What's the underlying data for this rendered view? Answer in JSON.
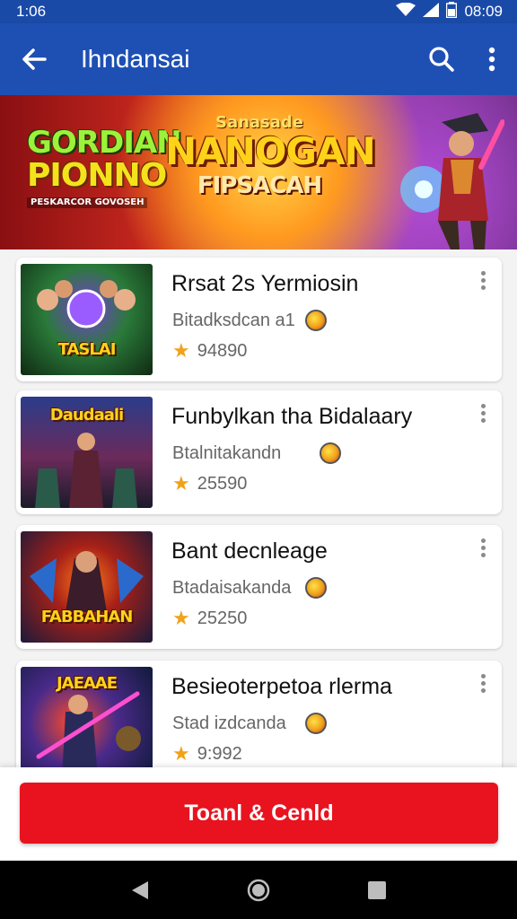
{
  "status_bar": {
    "left_time": "1:06",
    "right_time": "08:09"
  },
  "app_bar": {
    "title": "Ihndansai"
  },
  "banner": {
    "left_title_1": "GORDIAN",
    "left_title_2": "PIONNO",
    "left_subtitle": "PESKARCOR GOVOSEH",
    "center_small": "Sanasade",
    "center_title": "NANOGAN",
    "center_sub": "FIPSACAH"
  },
  "thumb_labels": [
    "TASLAI",
    "Daudaali",
    "FABBAHAN",
    "JAEAAE"
  ],
  "items": [
    {
      "name": "Rrsat 2s Yermiosin",
      "developer": "Bitadksdcan a1",
      "rating": "94890"
    },
    {
      "name": "Funbylkan tha Bidalaary",
      "developer": "Btalnitakandn",
      "rating": "25590"
    },
    {
      "name": "Bant decnleage",
      "developer": "Btadaisakanda",
      "rating": "25250"
    },
    {
      "name": "Besieoterpetoa rlerma",
      "developer": "Stad izdcanda",
      "rating": "9:992"
    }
  ],
  "cta": {
    "label": "Toanl & Cenld"
  },
  "colors": {
    "app_bar": "#1e50b4",
    "status_bar": "#1a4aa8",
    "cta": "#e8131f",
    "star": "#f0a21a"
  }
}
